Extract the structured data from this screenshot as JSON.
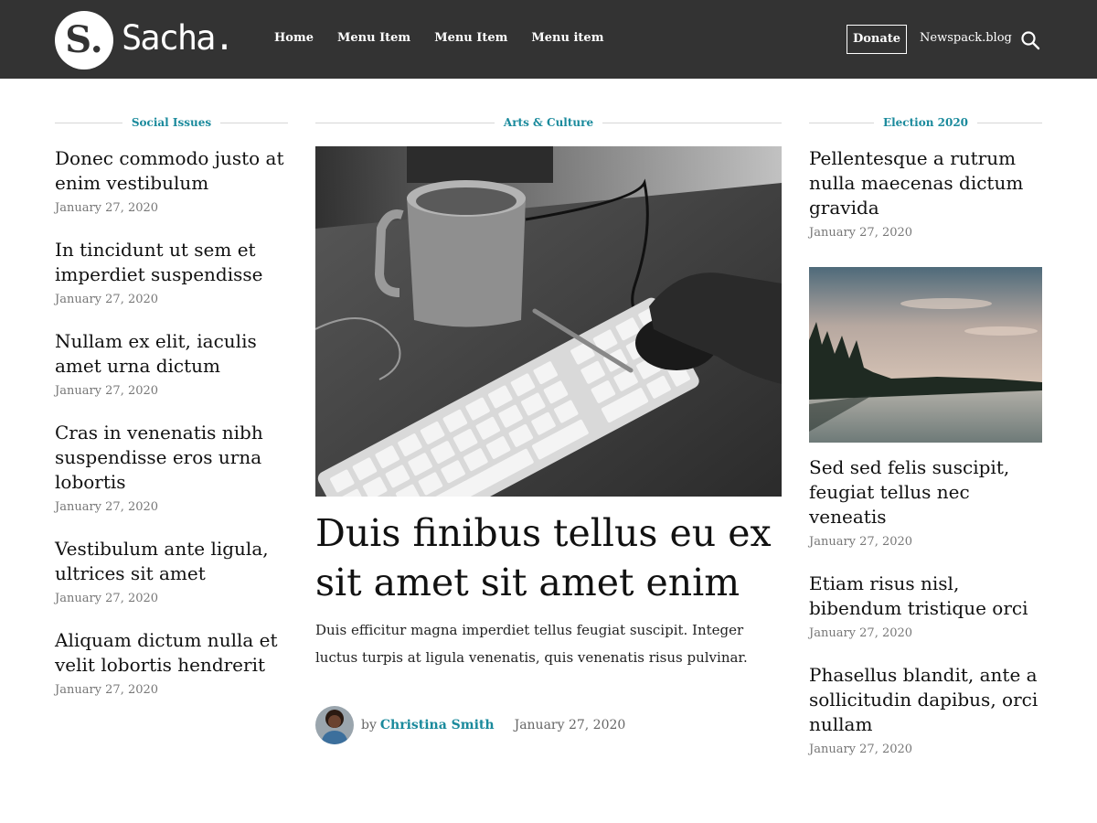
{
  "header": {
    "logo_letter": "S.",
    "site_name": "Sacha.",
    "nav": [
      "Home",
      "Menu Item",
      "Menu Item",
      "Menu item"
    ],
    "donate_label": "Donate",
    "site_link": "Newspack.blog",
    "background": "#333333"
  },
  "accent_color": "#1a8a9c",
  "sections": {
    "left": "Social Issues",
    "center": "Arts & Culture",
    "right": "Election 2020"
  },
  "left_articles": [
    {
      "title": "Donec commodo justo at enim vestibulum",
      "date": "January 27, 2020"
    },
    {
      "title": "In tincidunt ut sem et imperdiet suspendisse",
      "date": "January 27, 2020"
    },
    {
      "title": "Nullam ex elit, iaculis amet urna dictum",
      "date": "January 27, 2020"
    },
    {
      "title": "Cras in venenatis nibh suspendisse eros urna lobortis",
      "date": "January 27, 2020"
    },
    {
      "title": "Vestibulum ante ligula, ultrices sit amet",
      "date": "January 27, 2020"
    },
    {
      "title": "Aliquam dictum nulla et velit lobortis hendrerit",
      "date": "January 27, 2020"
    }
  ],
  "featured": {
    "title": "Duis finibus tellus eu ex sit amet sit amet enim",
    "excerpt": "Duis efficitur magna imperdiet tellus feugiat suscipit. Integer luctus turpis at ligula venenatis, quis venenatis risus pulvinar.",
    "by": "by",
    "author": "Christina Smith",
    "date": "January 27, 2020"
  },
  "right_articles": [
    {
      "title": "Pellentesque a rutrum nulla maecenas dictum gravida",
      "date": "January 27, 2020"
    },
    {
      "title": "Sed sed felis suscipit, feugiat tellus nec veneatis",
      "date": "January 27, 2020"
    },
    {
      "title": "Etiam risus nisl, bibendum tristique orci",
      "date": "January 27, 2020"
    },
    {
      "title": "Phasellus blandit, ante a sollicitudin dapibus, orci nullam",
      "date": "January 27, 2020"
    }
  ],
  "icons": {
    "search": "search-icon"
  }
}
